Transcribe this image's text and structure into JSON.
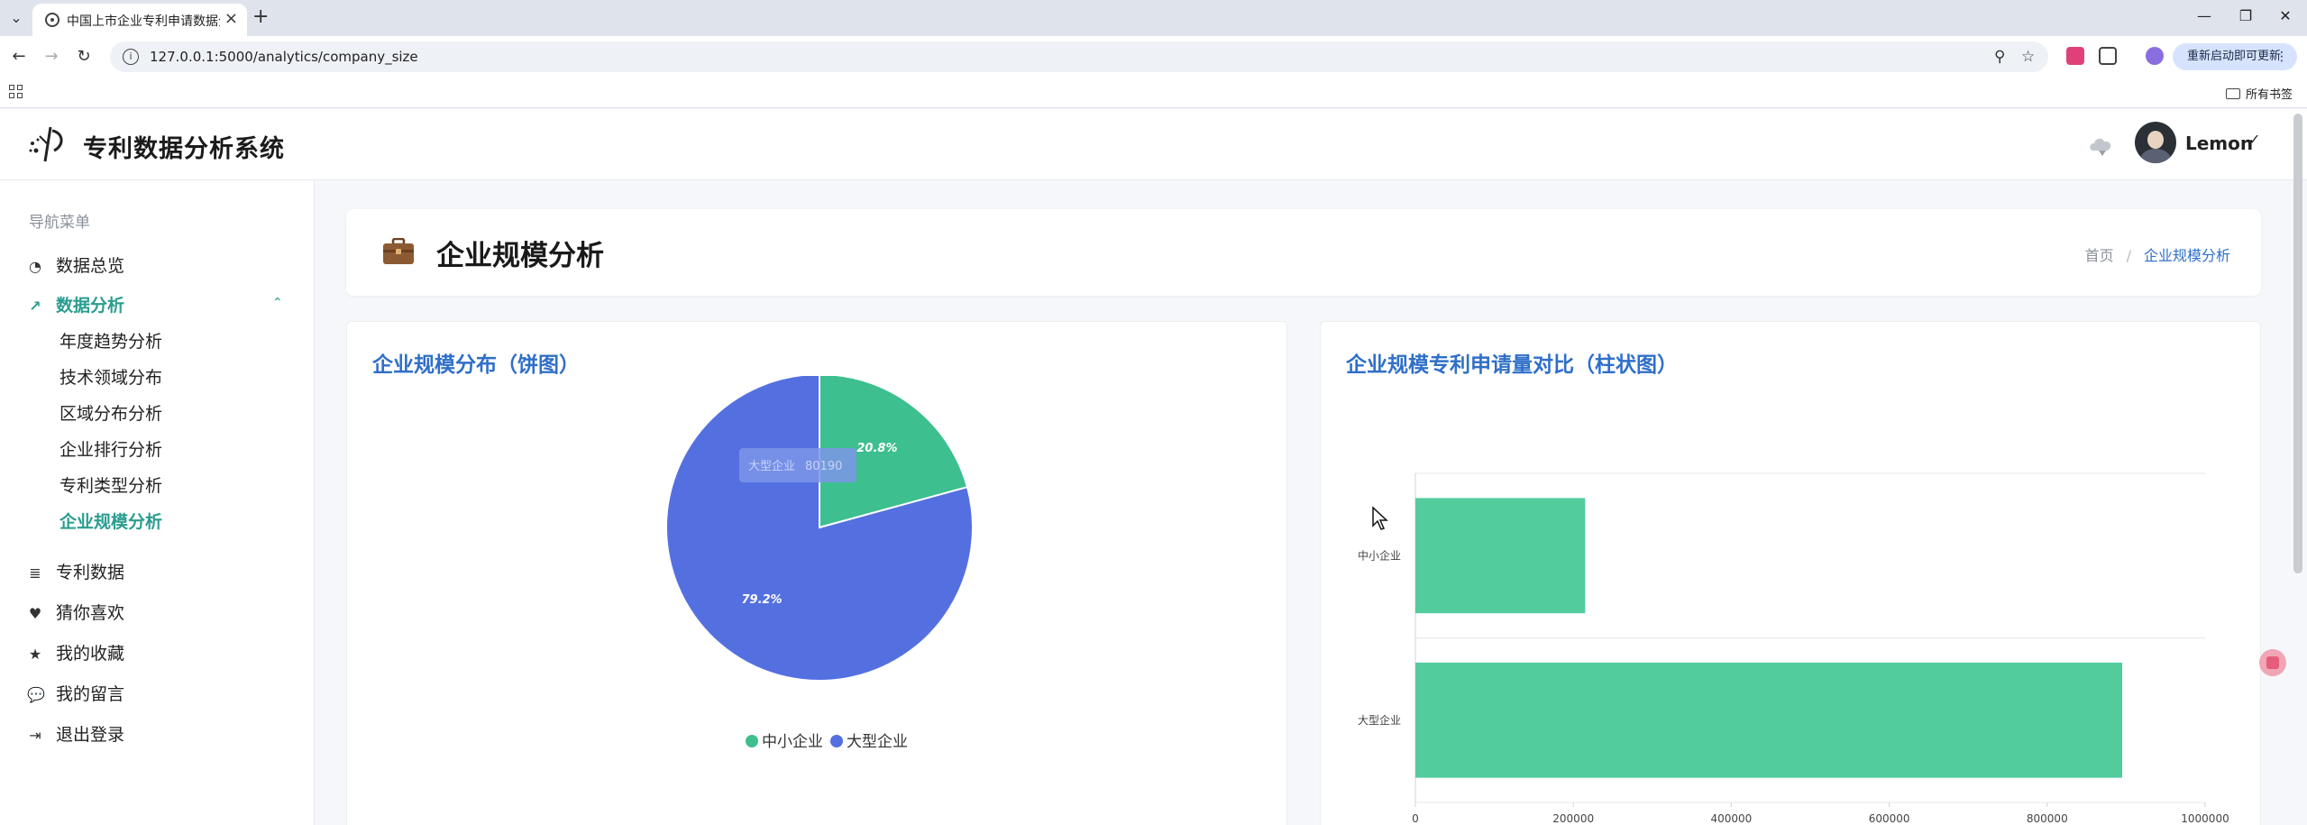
{
  "browser": {
    "tab_title": "中国上市企业专利申请数据分析",
    "url": "127.0.0.1:5000/analytics/company_size",
    "update_label": "重新启动即可更新",
    "bookmarks_all": "所有书签"
  },
  "app": {
    "title": "专利数据分析系统",
    "user_name": "Lemon"
  },
  "sidebar": {
    "heading": "导航菜单",
    "items": [
      {
        "label": "数据总览",
        "icon": "pie-chart-icon"
      },
      {
        "label": "数据分析",
        "icon": "line-chart-icon"
      },
      {
        "label": "专利数据",
        "icon": "database-icon"
      },
      {
        "label": "猜你喜欢",
        "icon": "heart-icon"
      },
      {
        "label": "我的收藏",
        "icon": "star-icon"
      },
      {
        "label": "我的留言",
        "icon": "comments-icon"
      },
      {
        "label": "退出登录",
        "icon": "sign-out-icon"
      }
    ],
    "sub_items": [
      "年度趋势分析",
      "技术领域分布",
      "区域分布分析",
      "企业排行分析",
      "专利类型分析",
      "企业规模分析"
    ]
  },
  "page": {
    "title": "企业规模分析",
    "breadcrumb_home": "首页",
    "breadcrumb_current": "企业规模分析"
  },
  "chart_data": [
    {
      "type": "pie",
      "title": "企业规模分布（饼图）",
      "categories": [
        "中小企业",
        "大型企业"
      ],
      "values": [
        21000,
        80190
      ],
      "slice_labels": [
        "20.8%",
        "79.2%"
      ],
      "colors": [
        "#3dbf8f",
        "#5470e0"
      ],
      "legend": "bottom",
      "tooltip": {
        "category": "大型企业",
        "value": "80190"
      }
    },
    {
      "type": "bar",
      "orientation": "horizontal",
      "title": "企业规模专利申请量对比（柱状图）",
      "categories": [
        "中小企业",
        "大型企业"
      ],
      "values": [
        215000,
        895000
      ],
      "xlim": [
        0,
        1000000
      ],
      "xticks": [
        "0",
        "200000",
        "400000",
        "600000",
        "800000",
        "1000000"
      ],
      "grid": true,
      "color": "#52cc9d"
    }
  ]
}
